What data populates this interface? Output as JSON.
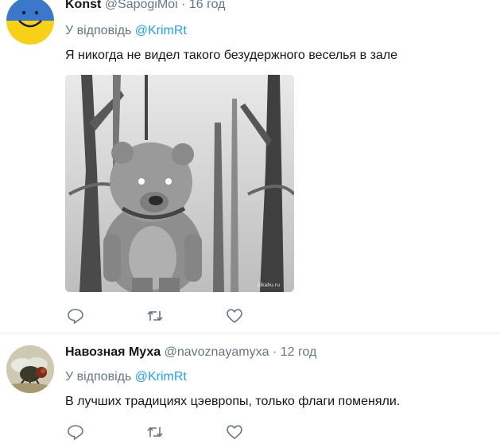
{
  "tweets": [
    {
      "name": "Konst",
      "handle": "@SapogiMoi",
      "separator": "·",
      "time": "16 год",
      "reply_prefix": "У відповідь",
      "reply_to": "@KrimRt",
      "text": "Я никогда не видел такого безудержного веселья в зале",
      "media_watermark": "pikabu.ru",
      "avatar_colors": {
        "top": "#3b78c9",
        "bottom": "#f7d117"
      }
    },
    {
      "name": "Навозная Муха",
      "handle": "@navoznayamyxa",
      "separator": "·",
      "time": "12 год",
      "reply_prefix": "У відповідь",
      "reply_to": "@KrimRt",
      "text": "В лучших традициях цэевропы, только флаги поменяли."
    }
  ],
  "icons": {
    "reply": "reply-icon",
    "retweet": "retweet-icon",
    "like": "like-icon"
  },
  "colors": {
    "link": "#1da1f2",
    "secondary": "#657786",
    "divider": "#e6ecf0"
  }
}
